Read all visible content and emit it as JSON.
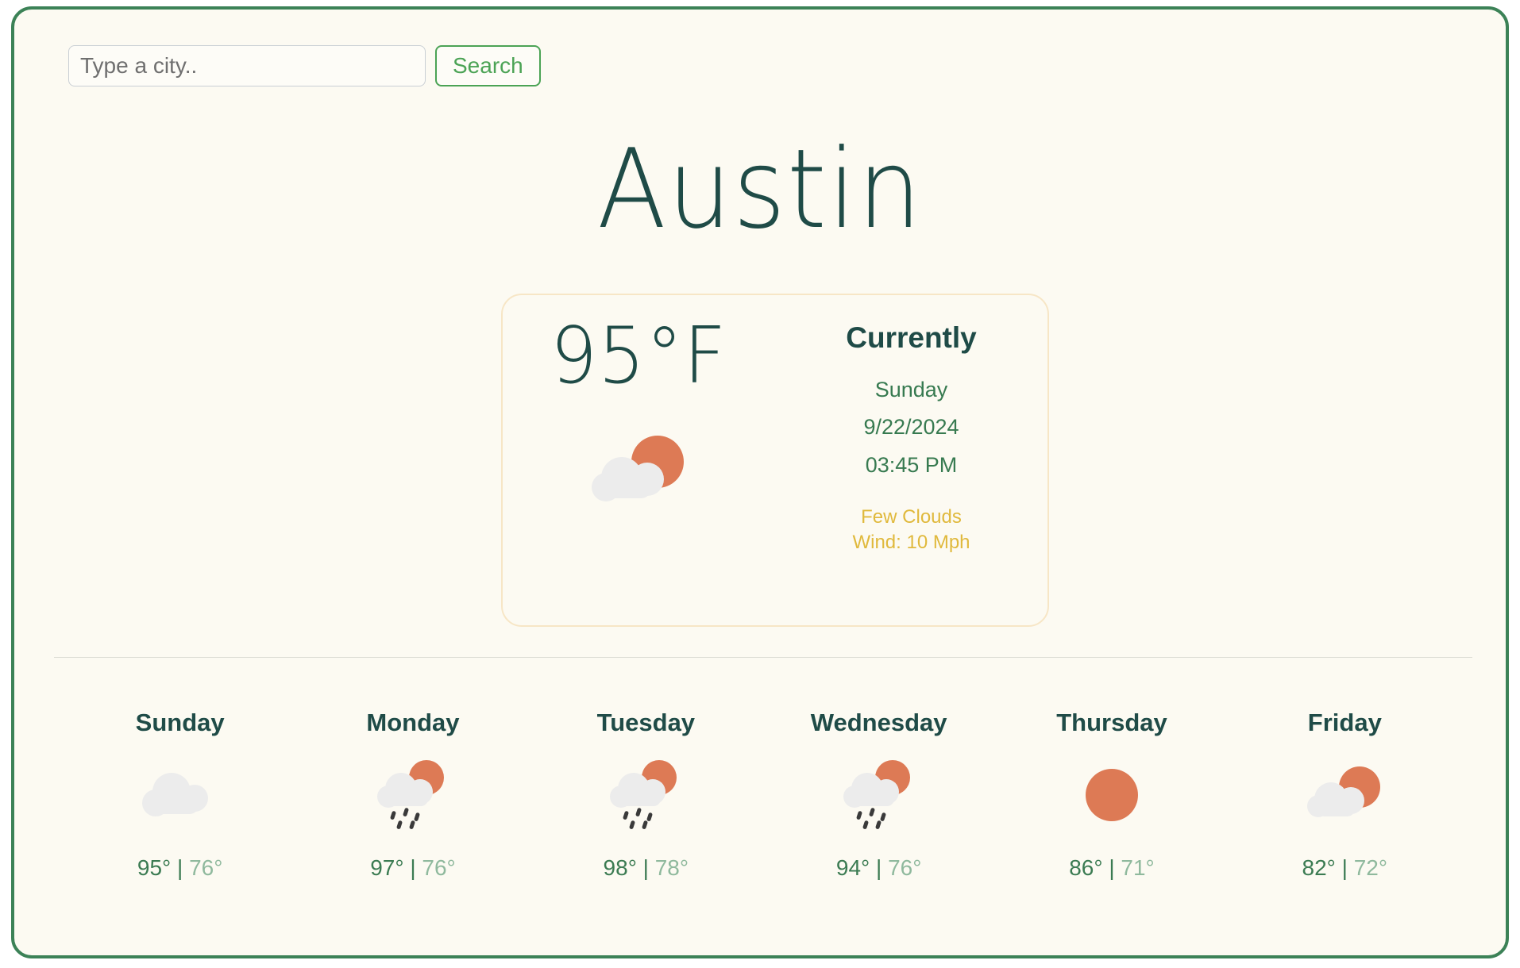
{
  "theme": {
    "page_bg": "#fcfaf2",
    "border_green": "#3c8257",
    "dark_teal": "#1f4b47",
    "green": "#377a50",
    "amber": "#e0b93c",
    "sun_orange": "#dd7a55",
    "cloud_gray": "#ececec",
    "card_border": "#f7e6c6",
    "muted_green": "#8fb99d"
  },
  "search": {
    "placeholder": "Type a city..",
    "value": "",
    "button_label": "Search"
  },
  "city": "Austin",
  "current": {
    "temperature": "95°F",
    "icon": "sun-behind-cloud-icon",
    "heading": "Currently",
    "day": "Sunday",
    "date": "9/22/2024",
    "time": "03:45 PM",
    "condition": "Few Clouds",
    "wind": "Wind: 10 Mph"
  },
  "forecast": [
    {
      "day": "Sunday",
      "icon": "cloud-icon",
      "high": "95°",
      "sep": "|",
      "low": "76°"
    },
    {
      "day": "Monday",
      "icon": "sun-cloud-rain-icon",
      "high": "97°",
      "sep": "|",
      "low": "76°"
    },
    {
      "day": "Tuesday",
      "icon": "sun-cloud-rain-icon",
      "high": "98°",
      "sep": "|",
      "low": "78°"
    },
    {
      "day": "Wednesday",
      "icon": "sun-cloud-rain-icon",
      "high": "94°",
      "sep": "|",
      "low": "76°"
    },
    {
      "day": "Thursday",
      "icon": "sun-icon",
      "high": "86°",
      "sep": "|",
      "low": "71°"
    },
    {
      "day": "Friday",
      "icon": "sun-behind-cloud-icon",
      "high": "82°",
      "sep": "|",
      "low": "72°"
    }
  ]
}
